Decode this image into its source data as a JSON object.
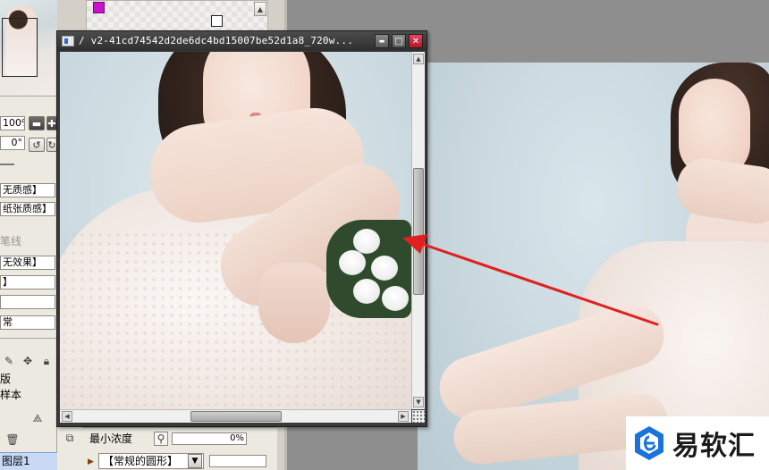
{
  "left_panel": {
    "zoom_value": "100%",
    "rotate_value": "0°",
    "texture_select": "无质感】",
    "texture_select_2": "纸张质感】",
    "line_label": "笔线",
    "effect_select": "无效果】",
    "effect_select_2": "】",
    "blend_mode": "常",
    "layer_option_1": "版",
    "layer_option_2": "样本",
    "layer_name": "图层1"
  },
  "popup": {
    "title": "/ v2-41cd74542d2de6dc4bd15007be52d1a8_720w...",
    "minimize_glyph": "▬",
    "maximize_glyph": "□",
    "close_glyph": "✕"
  },
  "bottom_props": {
    "min_density_label": "最小浓度",
    "min_density_value": "0%",
    "brush_shape_select": "【常规的圆形】",
    "expand_glyph": "▶",
    "dropdown_glyph": "▼"
  },
  "watermark": {
    "text": "易软汇"
  },
  "colors": {
    "foreground_swatch": "#cc11cc",
    "background_swatch": "#ffffff",
    "annotation_arrow": "#e02020",
    "popup_close": "#c8213a"
  },
  "icons": {
    "zoom_out": "minus-icon",
    "zoom_in": "plus-icon",
    "rotate_ccw": "rotate-left-icon",
    "rotate_cw": "rotate-right-icon",
    "pen": "pen-icon",
    "move": "move-icon",
    "lock": "lock-icon",
    "trash": "trash-icon",
    "layer_new": "new-layer-icon",
    "brush_settings": "brush-icon"
  }
}
